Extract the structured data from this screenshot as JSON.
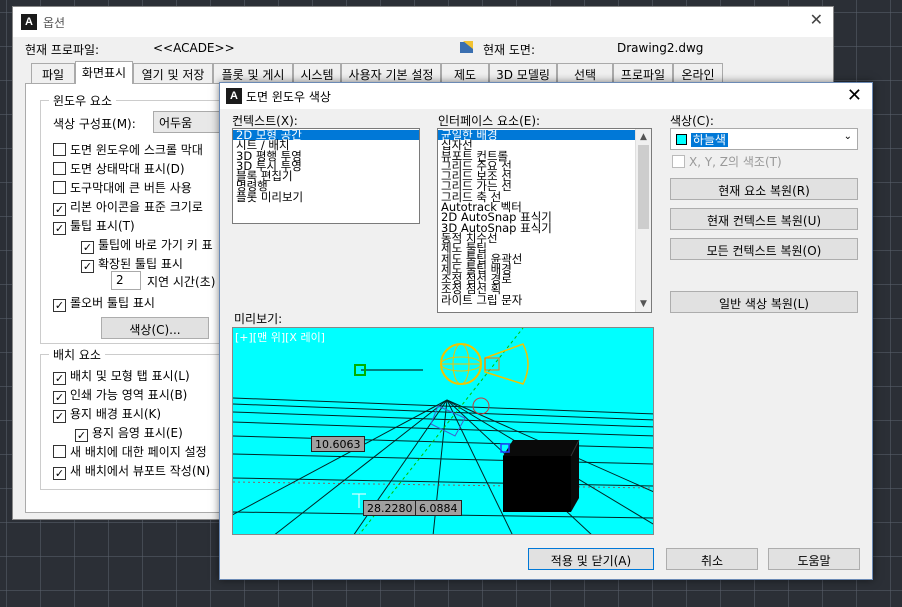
{
  "options_dialog": {
    "title": "옵션",
    "close_glyph": "✕",
    "profile_label": "현재 프로파일:",
    "profile_value": "<<ACADE>>",
    "drawing_label": "현재 도면:",
    "drawing_value": "Drawing2.dwg",
    "tabs": [
      "파일",
      "화면표시",
      "열기 및 저장",
      "플롯 및 게시",
      "시스템",
      "사용자 기본 설정",
      "제도",
      "3D 모델링",
      "선택",
      "프로파일",
      "온라인"
    ],
    "active_tab": "화면표시",
    "window_group": {
      "title": "윈도우 요소",
      "color_scheme_label": "색상 구성표(M):",
      "color_scheme_value": "어두움",
      "checkboxes": [
        {
          "label": "도면 윈도우에 스크롤 막대",
          "checked": false
        },
        {
          "label": "도면 상태막대 표시(D)",
          "checked": false
        },
        {
          "label": "도구막대에 큰 버튼 사용",
          "checked": false
        },
        {
          "label": "리본 아이콘을 표준 크기로",
          "checked": true
        },
        {
          "label": "툴팁 표시(T)",
          "checked": true
        },
        {
          "label": "툴팁에 바로 가기 키 표",
          "checked": true
        },
        {
          "label": "확장된 툴팁 표시",
          "checked": true
        }
      ],
      "delay_value": "2",
      "delay_label": "지연 시간(초)",
      "rollover_label": "롤오버 툴팁 표시",
      "rollover_checked": true,
      "colors_button": "색상(C)..."
    },
    "layout_group": {
      "title": "배치 요소",
      "checkboxes": [
        {
          "label": "배치 및 모형 탭 표시(L)",
          "checked": true
        },
        {
          "label": "인쇄 가능 영역 표시(B)",
          "checked": true
        },
        {
          "label": "용지 배경 표시(K)",
          "checked": true
        },
        {
          "label": "용지 음영 표시(E)",
          "checked": true
        },
        {
          "label": "새 배치에 대한 페이지 설정",
          "checked": false
        },
        {
          "label": "새 배치에서 뷰포트 작성(N)",
          "checked": true
        }
      ]
    }
  },
  "color_dialog": {
    "title": "도면 윈도우 색상",
    "close_glyph": "✕",
    "context_label": "컨텍스트(X):",
    "contexts": [
      "2D 모형 공간",
      "시트 / 배치",
      "3D 평행 투영",
      "3D 투시 투영",
      "블록 편집기",
      "명령행",
      "플롯 미리보기"
    ],
    "interface_label": "인터페이스 요소(E):",
    "interface_elements": [
      "균일한 배경",
      "십자선",
      "뷰포트 컨트롤",
      "그리드 주요 선",
      "그리드 보조 선",
      "그리드 가는 선",
      "그리드 축 선",
      "Autotrack 벡터",
      "2D AutoSnap 표식기",
      "3D AutoSnap 표식기",
      "동적 치수선",
      "제도 툴팁",
      "제도 툴팁 윤곽선",
      "제도 툴팁 배경",
      "조정 점선 경로",
      "조정 점선 획",
      "라이트 그립 문자"
    ],
    "color_label": "색상(C):",
    "color_value": "하늘색",
    "color_swatch": "#00ffff",
    "tint_label": "X, Y, Z의 색조(T)",
    "restore_element": "현재 요소 복원(R)",
    "restore_context": "현재 컨텍스트 복원(U)",
    "restore_all_contexts": "모든 컨텍스트 복원(O)",
    "restore_classic": "일반 색상 복원(L)",
    "preview_label": "미리보기:",
    "viewport_label": "[+][맨 위][X 레이]",
    "readouts": {
      "left": "10.6063",
      "bottom_x": "28.2280",
      "bottom_y": "6.0884"
    },
    "apply_close": "적용 및 닫기(A)",
    "cancel": "취소",
    "help": "도움말"
  }
}
